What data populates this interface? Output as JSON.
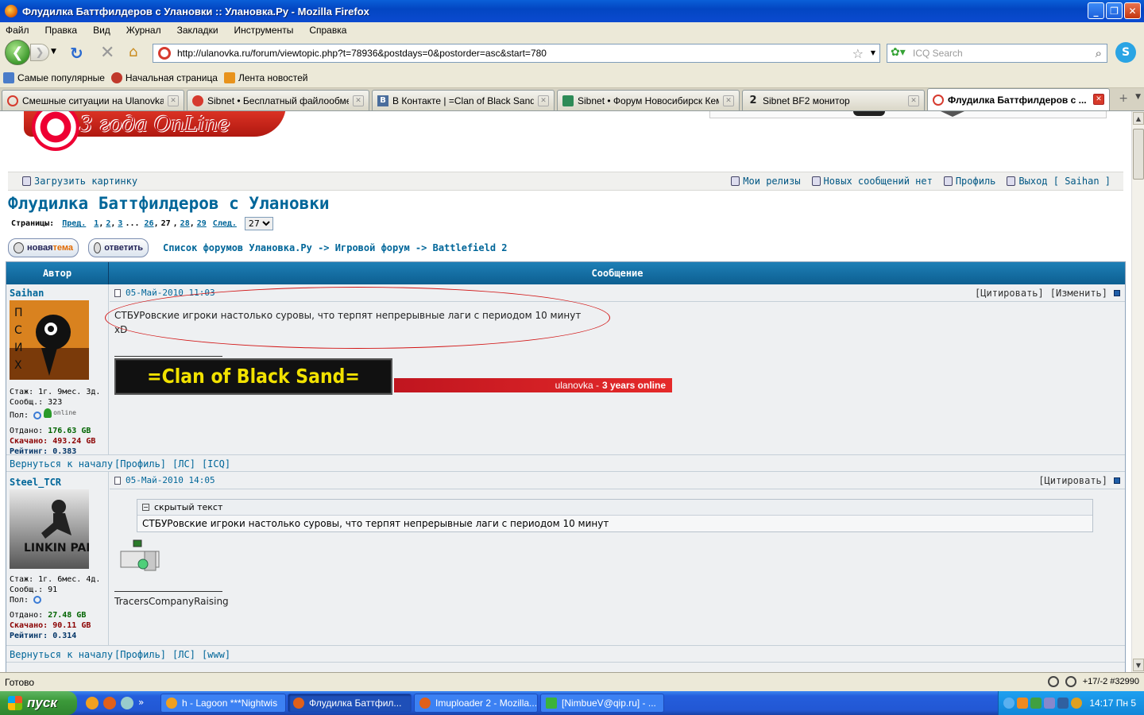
{
  "window": {
    "title": "Флудилка Баттфилдеров с Улановки :: Улановка.Ру - Mozilla Firefox",
    "min": "_",
    "max": "❐",
    "close": "✕"
  },
  "menu": [
    "Файл",
    "Правка",
    "Вид",
    "Журнал",
    "Закладки",
    "Инструменты",
    "Справка"
  ],
  "nav": {
    "url": "http://ulanovka.ru/forum/viewtopic.php?t=78936&postdays=0&postorder=asc&start=780",
    "search_placeholder": "ICQ Search"
  },
  "bookmarks": [
    "Самые популярные",
    "Начальная страница",
    "Лента новостей"
  ],
  "tabs": [
    {
      "label": "Смешные ситуации на Ulanovka.r...",
      "icon": "ulanovka-icon"
    },
    {
      "label": "Sibnet • Бесплатный файлообмен...",
      "icon": "sibnet-icon"
    },
    {
      "label": "В Контакте | =Clan of Black Sand...",
      "icon": "vk-icon",
      "glyph": "B"
    },
    {
      "label": "Sibnet • Форум Новосибирск Кеме...",
      "icon": "sibnet-forum-icon"
    },
    {
      "label": "Sibnet BF2 монитор",
      "icon": "bf2-icon",
      "glyph": "2"
    },
    {
      "label": "Флудилка Баттфилдеров с ...",
      "icon": "ulanovka-icon",
      "active": true
    }
  ],
  "site": {
    "slogan": "3 года OnLine",
    "userbar_left": "Загрузить картинку",
    "userbar_right": [
      "Мои релизы",
      "Новых сообщений нет",
      "Профиль",
      "Выход [ Saihan ]"
    ]
  },
  "topic": {
    "title": "Флудилка Баттфилдеров с Улановки",
    "pages_label": "Страницы:",
    "prev": "Пред.",
    "pages": [
      "1",
      "2",
      "3",
      "...",
      "26",
      "27",
      "28",
      "29"
    ],
    "current_page": "27",
    "next": "След.",
    "page_select": "27",
    "new_topic": {
      "a": "новая ",
      "b": "тема"
    },
    "reply": "ответить",
    "breadcrumb": {
      "root": "Список форумов Улановка.Ру",
      "sep": "->",
      "forum": "Игровой форум",
      "sub": "Battlefield 2"
    }
  },
  "table": {
    "col_author": "Автор",
    "col_message": "Сообщение"
  },
  "posts": [
    {
      "author": "Saihan",
      "stazh": "Стаж: 1г. 9мес. 3д.",
      "msgs": "Сообщ.: 323",
      "pol": "Пол:",
      "online": "online",
      "otdano_label": "Отдано:",
      "otdano": "176.63 GB",
      "skachano_label": "Скачано:",
      "skachano": "493.24 GB",
      "rating_label": "Рейтинг:",
      "rating": "0.383",
      "date": "05-Май-2010 11:03",
      "actions": [
        "[Цитировать]",
        "[Изменить]"
      ],
      "text": "СТБУРовские игроки настолько суровы, что терпят непрерывные лаги с периодом 10 минут",
      "text2": "xD",
      "sig_clan": "=Clan of Black Sand=",
      "sig_banner": "ulanovka - ",
      "sig_banner_bold": "3 years online",
      "foot_left": "Вернуться к началу",
      "foot_links": [
        "[Профиль]",
        "[ЛС]",
        "[ICQ]"
      ]
    },
    {
      "author": "Steel_TCR",
      "stazh": "Стаж: 1г. 6мес. 4д.",
      "msgs": "Сообщ.: 91",
      "pol": "Пол:",
      "otdano_label": "Отдано:",
      "otdano": "27.48 GB",
      "skachano_label": "Скачано:",
      "skachano": "90.11 GB",
      "rating_label": "Рейтинг:",
      "rating": "0.314",
      "date": "05-Май-2010 14:05",
      "actions": [
        "[Цитировать]"
      ],
      "hidden_label": "скрытый текст",
      "hidden_text": "СТБУРовские игроки настолько суровы, что терпят непрерывные лаги с периодом 10 минут",
      "sig_text": "TracersCompanyRaising",
      "avatar_text": "LINKIN PARK",
      "foot_left": "Вернуться к началу",
      "foot_links": [
        "[Профиль]",
        "[ЛС]",
        "[www]"
      ]
    }
  ],
  "status": {
    "text": "Готово",
    "right": "+17/-2  #32990"
  },
  "taskbar": {
    "start": "пуск",
    "more": "»",
    "items": [
      {
        "label": "h - Lagoon ***Nightwis"
      },
      {
        "label": "Флудилка Баттфил...",
        "active": true
      },
      {
        "label": "Imuploader 2 - Mozilla..."
      },
      {
        "label": "[NimbueV@qip.ru] - ..."
      }
    ],
    "clock": "14:17 Пн 5"
  },
  "colors": {
    "link": "#006699",
    "header": "#1e7fb6",
    "annotation": "#d21414"
  }
}
